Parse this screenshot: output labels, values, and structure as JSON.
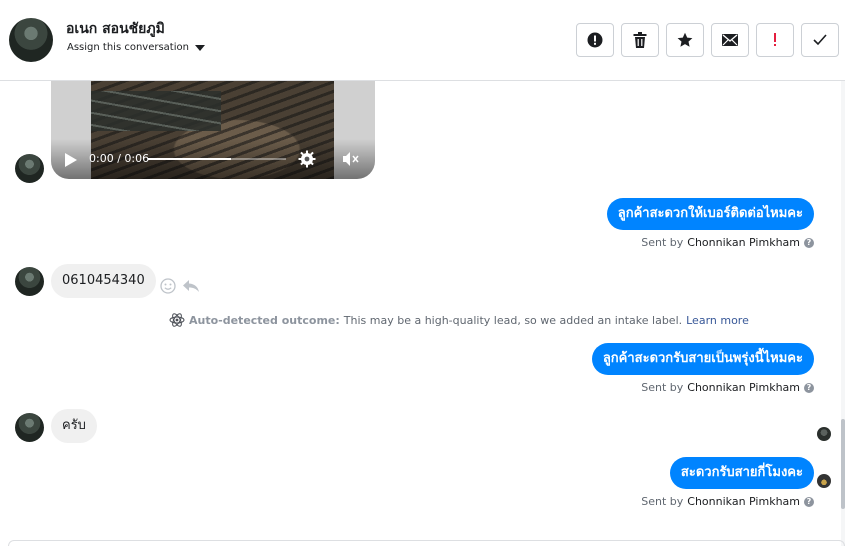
{
  "header": {
    "contact_name": "อเนก สอนชัยภูมิ",
    "assign_label": "Assign this conversation"
  },
  "toolbar": {
    "buttons": [
      {
        "name": "report-spam",
        "icon": "alert-circle-icon"
      },
      {
        "name": "delete",
        "icon": "trash-icon"
      },
      {
        "name": "star",
        "icon": "star-icon"
      },
      {
        "name": "mark-unread",
        "icon": "envelope-icon"
      },
      {
        "name": "follow-up",
        "icon": "exclamation-icon",
        "color": "#e41e3f"
      },
      {
        "name": "mark-done",
        "icon": "check-icon"
      }
    ]
  },
  "video": {
    "time_display": "0:00 / 0:06"
  },
  "messages": [
    {
      "direction": "out",
      "text": "ลูกค้าสะดวกให้เบอร์ติดต่อไหมคะ",
      "sent_by_prefix": "Sent by",
      "sender": "Chonnikan Pimkham"
    },
    {
      "direction": "in",
      "text": "0610454340"
    },
    {
      "direction": "out",
      "text": "ลูกค้าสะดวกรับสายเป็นพรุ่งนี้ไหมคะ",
      "sent_by_prefix": "Sent by",
      "sender": "Chonnikan Pimkham"
    },
    {
      "direction": "in",
      "text": "ครับ"
    },
    {
      "direction": "out",
      "text": "สะดวกรับสายกี่โมงคะ",
      "sent_by_prefix": "Sent by",
      "sender": "Chonnikan Pimkham"
    }
  ],
  "outcome": {
    "label": "Auto-detected outcome:",
    "text": "This may be a high-quality lead, so we added an intake label.",
    "link": "Learn more"
  },
  "colors": {
    "outgoing_bubble": "#0084ff",
    "incoming_bubble": "#f0f0f0",
    "link": "#385898"
  }
}
